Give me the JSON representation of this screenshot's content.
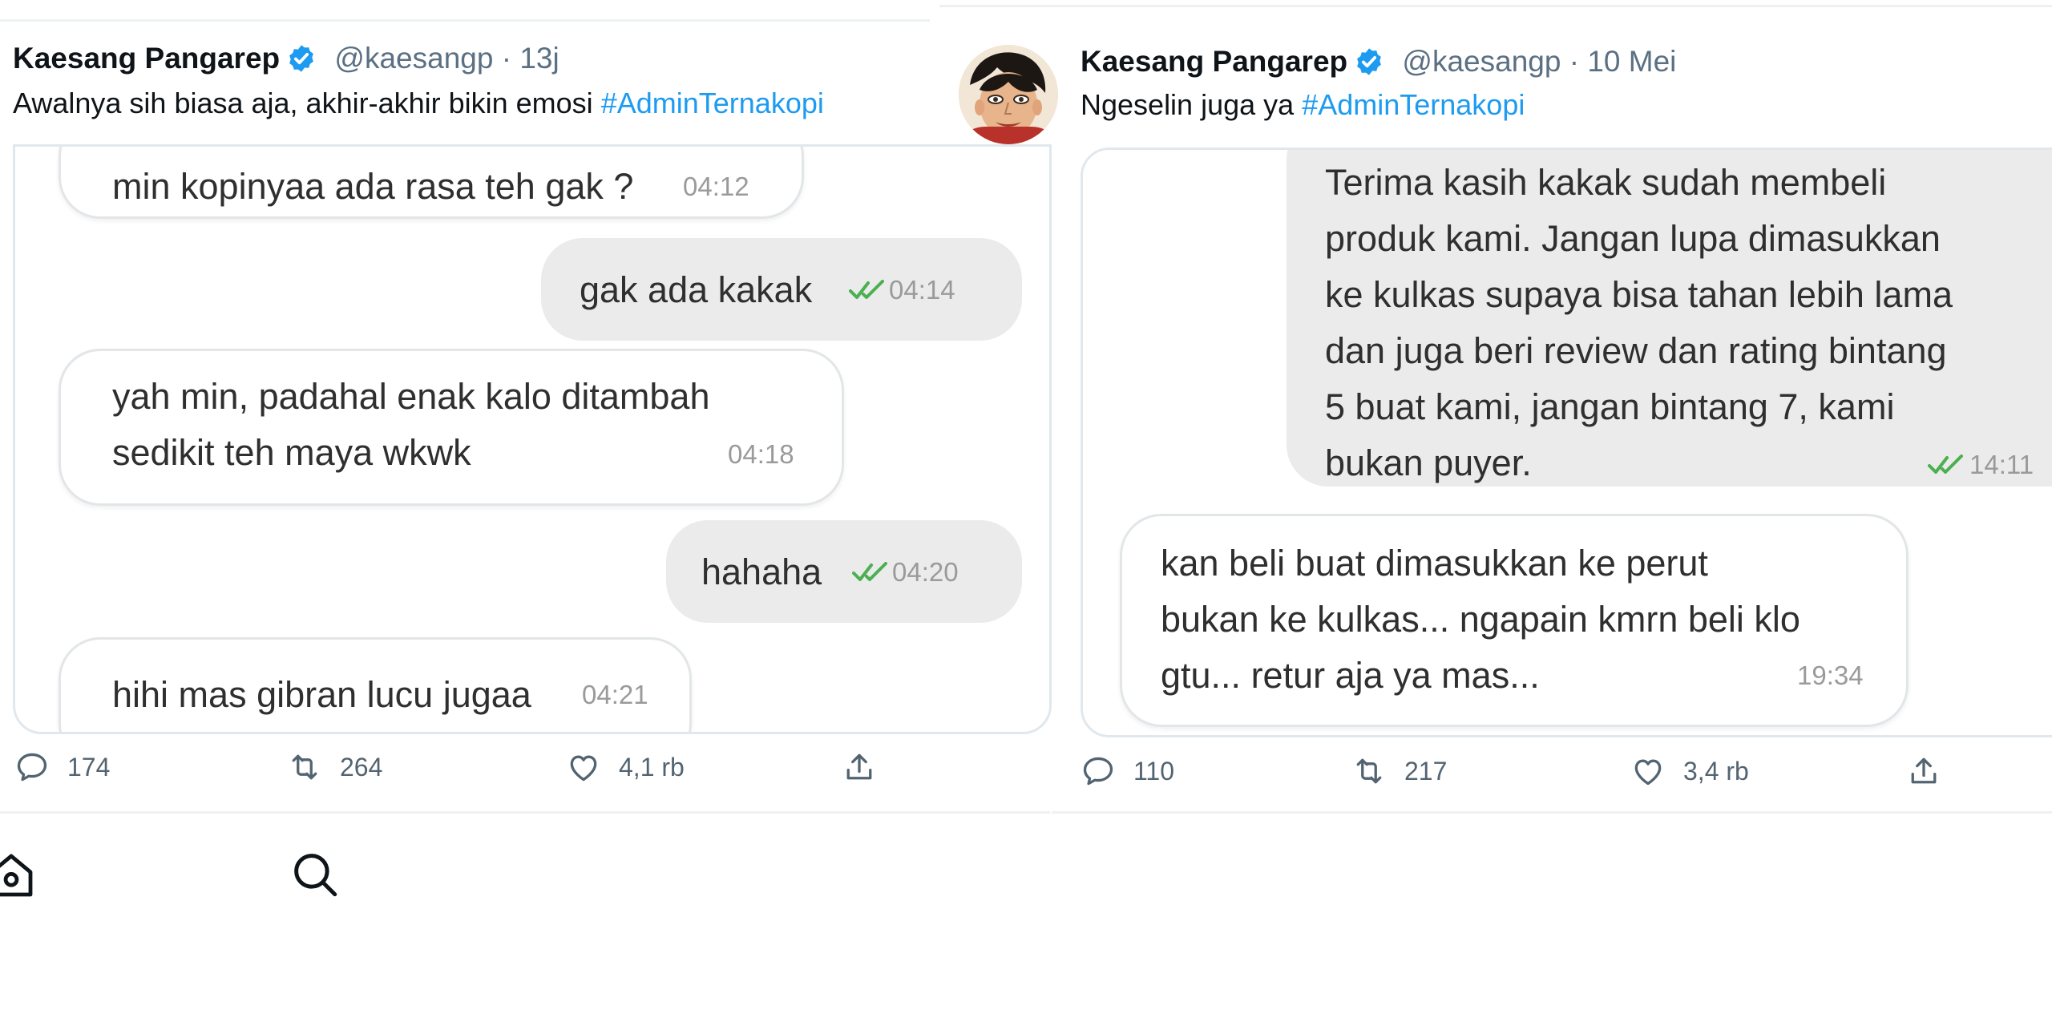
{
  "left": {
    "author_name": "Kaesang Pangarep",
    "handle": "@kaesangp",
    "separator": "·",
    "date": "13j",
    "text": "Awalnya sih biasa aja, akhir-akhir bikin emosi",
    "hashtag": "#AdminTernakopi",
    "messages": [
      {
        "text": "min kopinyaa ada rasa teh gak ?",
        "time": "04:12"
      },
      {
        "text": "gak ada kakak",
        "time": "04:14"
      },
      {
        "line1": "yah min, padahal enak kalo ditambah",
        "line2": "sedikit teh maya wkwk",
        "time": "04:18"
      },
      {
        "text": "hahaha",
        "time": "04:20"
      },
      {
        "text": "hihi mas gibran lucu jugaa",
        "time": "04:21"
      }
    ],
    "replies": "174",
    "retweets": "264",
    "likes": "4,1 rb"
  },
  "right": {
    "author_name": "Kaesang Pangarep",
    "handle": "@kaesangp",
    "separator": "·",
    "date": "10 Mei",
    "text": "Ngeselin juga ya",
    "hashtag": "#AdminTernakopi",
    "messages": [
      {
        "lines": [
          "Terima kasih kakak sudah membeli",
          "produk kami. Jangan lupa dimasukkan",
          "ke kulkas supaya bisa tahan lebih lama",
          "dan juga beri review dan rating bintang",
          "5 buat kami, jangan bintang 7, kami",
          "bukan puyer."
        ],
        "time": "14:11"
      },
      {
        "lines": [
          "kan beli buat dimasukkan ke perut",
          "bukan ke kulkas... ngapain kmrn beli klo",
          "gtu... retur aja ya mas..."
        ],
        "time": "19:34"
      }
    ],
    "replies": "110",
    "retweets": "217",
    "likes": "3,4 rb"
  },
  "colors": {
    "hashtag": "#1d9bf0",
    "verified": "#1d9bf0",
    "read_tick": "#4caf50",
    "muted": "#536471"
  },
  "icons": [
    "verified-badge-icon",
    "reply-icon",
    "retweet-icon",
    "like-icon",
    "share-icon",
    "home-icon",
    "search-icon"
  ]
}
